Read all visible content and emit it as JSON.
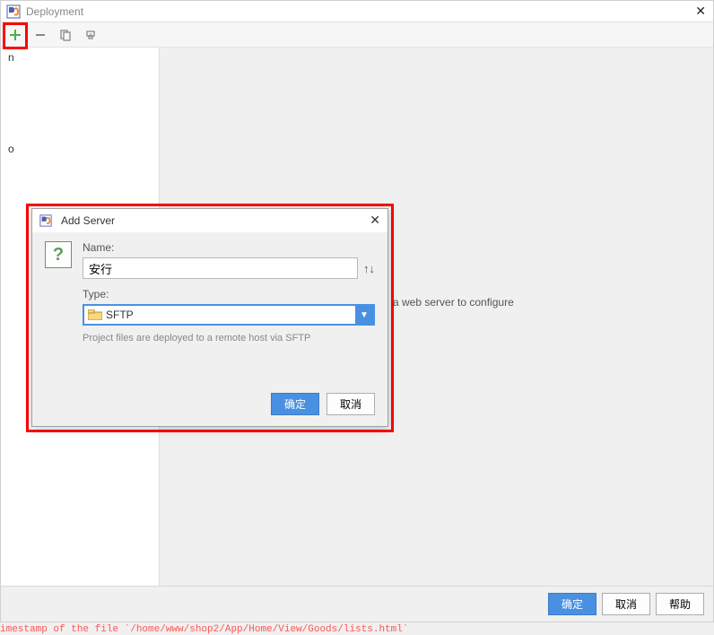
{
  "window": {
    "title": "Deployment"
  },
  "sidebar": {
    "partial_text_top": "n",
    "partial_text_mid": "o"
  },
  "main": {
    "hint": "a web server to configure"
  },
  "dialog": {
    "title": "Add Server",
    "qmark": "?",
    "name_label": "Name:",
    "name_value": "安行",
    "type_label": "Type:",
    "type_value": "SFTP",
    "description": "Project files are deployed to a remote host via SFTP",
    "ok": "确定",
    "cancel": "取消"
  },
  "footer": {
    "ok": "确定",
    "cancel": "取消",
    "help": "帮助"
  },
  "status": {
    "text": "imestamp of the file `/home/www/shop2/App/Home/View/Goods/lists.html`"
  }
}
